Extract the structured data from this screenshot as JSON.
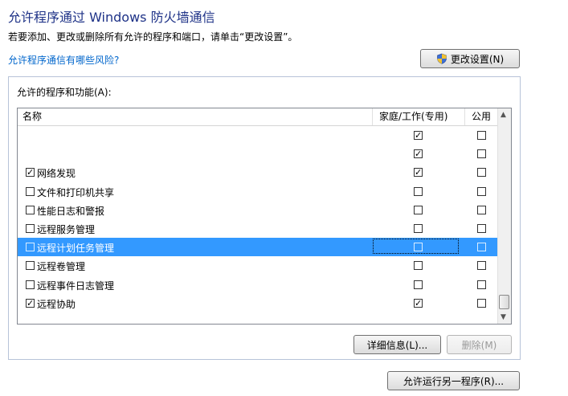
{
  "header": {
    "title": "允许程序通过 Windows 防火墙通信",
    "subtitle": "若要添加、更改或删除所有允许的程序和端口，请单击“更改设置”。",
    "risk_link": "允许程序通信有哪些风险?",
    "change_settings": "更改设置(N)"
  },
  "group": {
    "label": "允许的程序和功能(A):"
  },
  "table": {
    "columns": [
      "名称",
      "家庭/工作(专用)",
      "公用"
    ],
    "rows": [
      {
        "name": "",
        "name_check": null,
        "home": "☑",
        "public": "☐",
        "selected": false
      },
      {
        "name": "",
        "name_check": null,
        "home": "☑",
        "public": "☐",
        "selected": false
      },
      {
        "name": "网络发现",
        "name_check": "☑",
        "home": "☑",
        "public": "☐",
        "selected": false
      },
      {
        "name": "文件和打印机共享",
        "name_check": "☐",
        "home": "☐",
        "public": "☐",
        "selected": false
      },
      {
        "name": "性能日志和警报",
        "name_check": "☐",
        "home": "☐",
        "public": "☐",
        "selected": false
      },
      {
        "name": "远程服务管理",
        "name_check": "☐",
        "home": "☐",
        "public": "☐",
        "selected": false
      },
      {
        "name": "远程计划任务管理",
        "name_check": "☐",
        "home": "☐",
        "public": "☐",
        "selected": true
      },
      {
        "name": "远程卷管理",
        "name_check": "☐",
        "home": "☐",
        "public": "☐",
        "selected": false
      },
      {
        "name": "远程事件日志管理",
        "name_check": "☐",
        "home": "☐",
        "public": "☐",
        "selected": false
      },
      {
        "name": "远程协助",
        "name_check": "☑",
        "home": "☑",
        "public": "☐",
        "selected": false
      }
    ]
  },
  "buttons": {
    "details": "详细信息(L)...",
    "remove": "删除(M)",
    "allow_other": "允许运行另一程序(R)..."
  },
  "icons": {
    "shield": "shield-icon",
    "scroll_up": "scroll-up-arrow-icon",
    "scroll_down": "scroll-down-arrow-icon"
  },
  "colors": {
    "title": "#1e3287",
    "link": "#0066cc",
    "selection": "#3399ff"
  }
}
